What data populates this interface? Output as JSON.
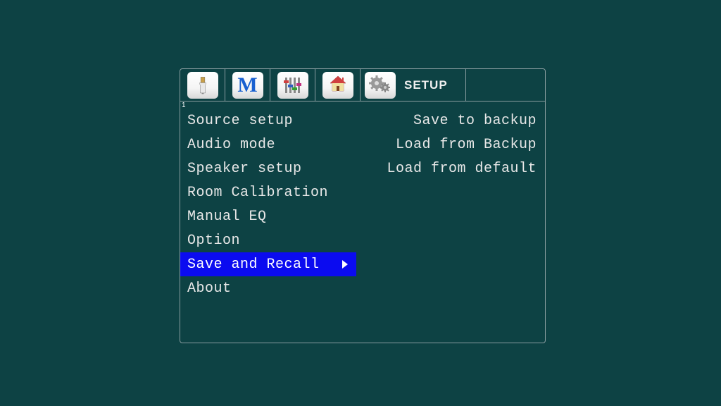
{
  "tabs": {
    "icons": [
      "hdmi",
      "m-letter",
      "sliders",
      "house",
      "gears"
    ],
    "active_label": "SETUP"
  },
  "marker": "1",
  "left_menu": [
    {
      "label": "Source setup",
      "selected": false
    },
    {
      "label": "Audio mode",
      "selected": false
    },
    {
      "label": "Speaker setup",
      "selected": false
    },
    {
      "label": "Room Calibration",
      "selected": false
    },
    {
      "label": "Manual EQ",
      "selected": false
    },
    {
      "label": "Option",
      "selected": false
    },
    {
      "label": "Save and Recall",
      "selected": true
    },
    {
      "label": "About",
      "selected": false
    }
  ],
  "right_menu": [
    {
      "label": "Save to backup"
    },
    {
      "label": "Load from Backup"
    },
    {
      "label": "Load from default"
    }
  ]
}
